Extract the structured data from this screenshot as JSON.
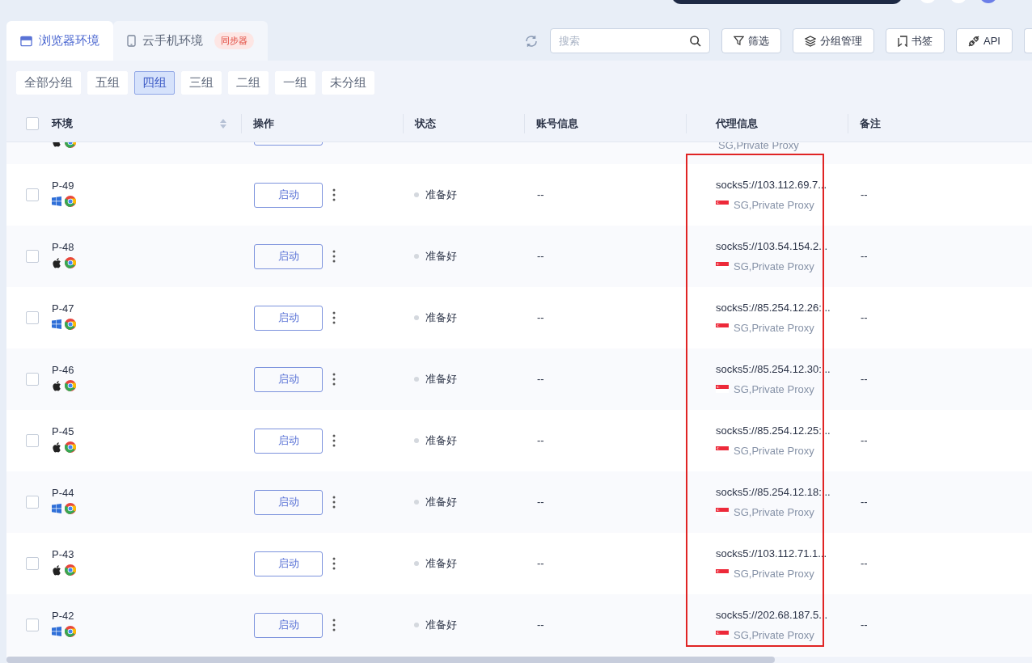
{
  "tabs": [
    {
      "label": "浏览器环境",
      "kind": "browser",
      "selected": true
    },
    {
      "label": "云手机环境",
      "kind": "phone",
      "selected": false,
      "badge": "同步器"
    }
  ],
  "search": {
    "placeholder": "搜索"
  },
  "toolbar": [
    {
      "label": "筛选",
      "kind": "filter"
    },
    {
      "label": "分组管理",
      "kind": "layers"
    },
    {
      "label": "书签",
      "kind": "bookmark"
    },
    {
      "label": "API",
      "kind": "api"
    }
  ],
  "groups": [
    {
      "label": "全部分组",
      "selected": false
    },
    {
      "label": "五组",
      "selected": false
    },
    {
      "label": "四组",
      "selected": true
    },
    {
      "label": "三组",
      "selected": false
    },
    {
      "label": "二组",
      "selected": false
    },
    {
      "label": "一组",
      "selected": false
    },
    {
      "label": "未分组",
      "selected": false
    }
  ],
  "table": {
    "all_checked": false,
    "columns": [
      "环境",
      "操作",
      "状态",
      "账号信息",
      "代理信息",
      "备注"
    ],
    "partial_row": {
      "kind": "mac",
      "region": "SG,Private Proxy"
    },
    "rows": [
      {
        "name": "P-49",
        "kind": "windows",
        "action": "启动",
        "status": "准备好",
        "account": "--",
        "proxy": "socks5://103.112.69.7...",
        "region": "SG,Private Proxy",
        "note": "--",
        "checked": false
      },
      {
        "name": "P-48",
        "kind": "mac",
        "action": "启动",
        "status": "准备好",
        "account": "--",
        "proxy": "socks5://103.54.154.2...",
        "region": "SG,Private Proxy",
        "note": "--",
        "checked": false
      },
      {
        "name": "P-47",
        "kind": "windows",
        "action": "启动",
        "status": "准备好",
        "account": "--",
        "proxy": "socks5://85.254.12.26:...",
        "region": "SG,Private Proxy",
        "note": "--",
        "checked": false
      },
      {
        "name": "P-46",
        "kind": "mac",
        "action": "启动",
        "status": "准备好",
        "account": "--",
        "proxy": "socks5://85.254.12.30:...",
        "region": "SG,Private Proxy",
        "note": "--",
        "checked": false
      },
      {
        "name": "P-45",
        "kind": "mac",
        "action": "启动",
        "status": "准备好",
        "account": "--",
        "proxy": "socks5://85.254.12.25:...",
        "region": "SG,Private Proxy",
        "note": "--",
        "checked": false
      },
      {
        "name": "P-44",
        "kind": "windows",
        "action": "启动",
        "status": "准备好",
        "account": "--",
        "proxy": "socks5://85.254.12.18:...",
        "region": "SG,Private Proxy",
        "note": "--",
        "checked": false
      },
      {
        "name": "P-43",
        "kind": "mac",
        "action": "启动",
        "status": "准备好",
        "account": "--",
        "proxy": "socks5://103.112.71.1...",
        "region": "SG,Private Proxy",
        "note": "--",
        "checked": false
      },
      {
        "name": "P-42",
        "kind": "windows",
        "action": "启动",
        "status": "准备好",
        "account": "--",
        "proxy": "socks5://202.68.187.5...",
        "region": "SG,Private Proxy",
        "note": "--",
        "checked": false
      }
    ]
  }
}
